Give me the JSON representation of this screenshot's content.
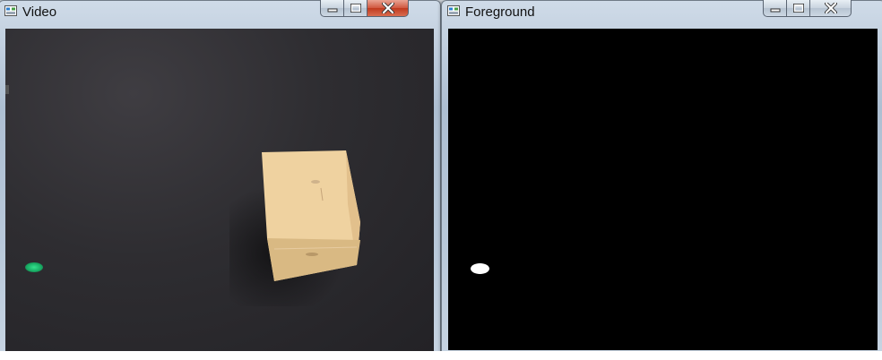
{
  "windows": {
    "video": {
      "title": "Video",
      "icon": "app-window-icon",
      "buttons": [
        "minimize-icon",
        "maximize-icon",
        "close-icon"
      ],
      "close_state": "hover-red",
      "accent": "#c8472a"
    },
    "foreground": {
      "title": "Foreground",
      "icon": "app-window-icon",
      "buttons": [
        "minimize-icon",
        "maximize-icon",
        "close-icon"
      ],
      "close_state": "normal"
    }
  },
  "scene": {
    "video_objects": [
      "cardboard-box",
      "green-marker"
    ],
    "foreground_objects": [
      "white-blob"
    ]
  },
  "colors": {
    "frame": "#b9c9da",
    "video_bg": "#2e2d31",
    "foreground_bg": "#000000",
    "box": "#efd2a0",
    "marker": "#1fb56e",
    "blob": "#ffffff"
  }
}
